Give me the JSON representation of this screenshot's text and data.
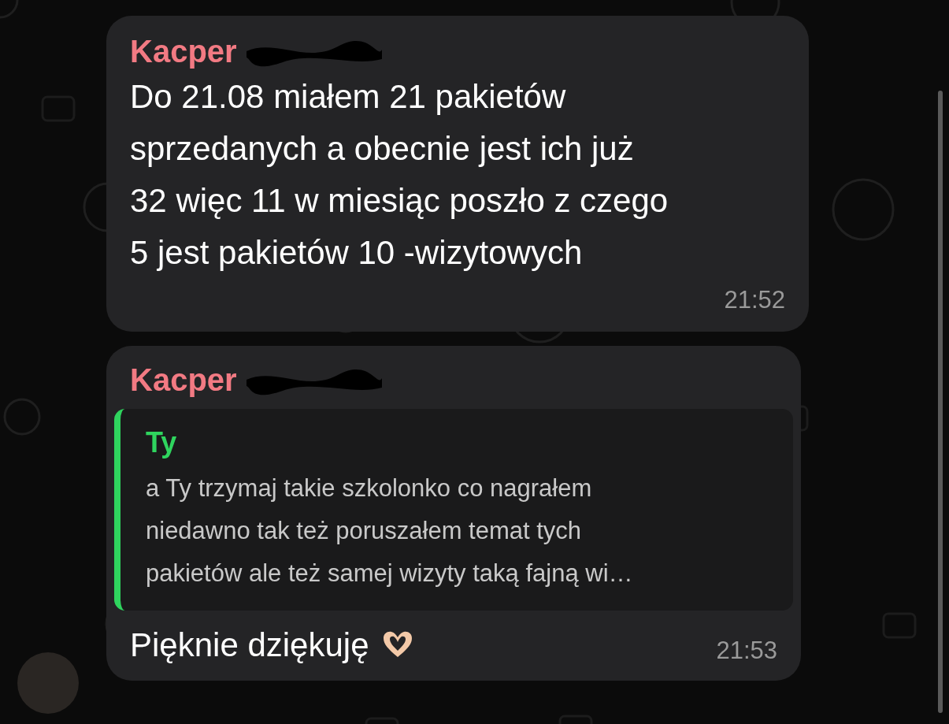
{
  "messages": [
    {
      "kind": "text",
      "sender": "Kacper",
      "sender_redacted": true,
      "text": "Do 21.08 miałem 21 pakietów\nsprzedanych a obecnie jest ich już\n32 więc 11 w miesiąc poszło z czego\n5 jest pakietów 10 -wizytowych",
      "time": "21:52"
    },
    {
      "kind": "reply",
      "sender": "Kacper",
      "sender_redacted": true,
      "quote": {
        "author": "Ty",
        "text": "a Ty trzymaj takie szkolonko co nagrałem\nniedawno tak też poruszałem temat tych\npakietów ale też samej wizyty taką fajną wi…"
      },
      "text": "Pięknie dziękuję",
      "time": "21:53"
    }
  ]
}
